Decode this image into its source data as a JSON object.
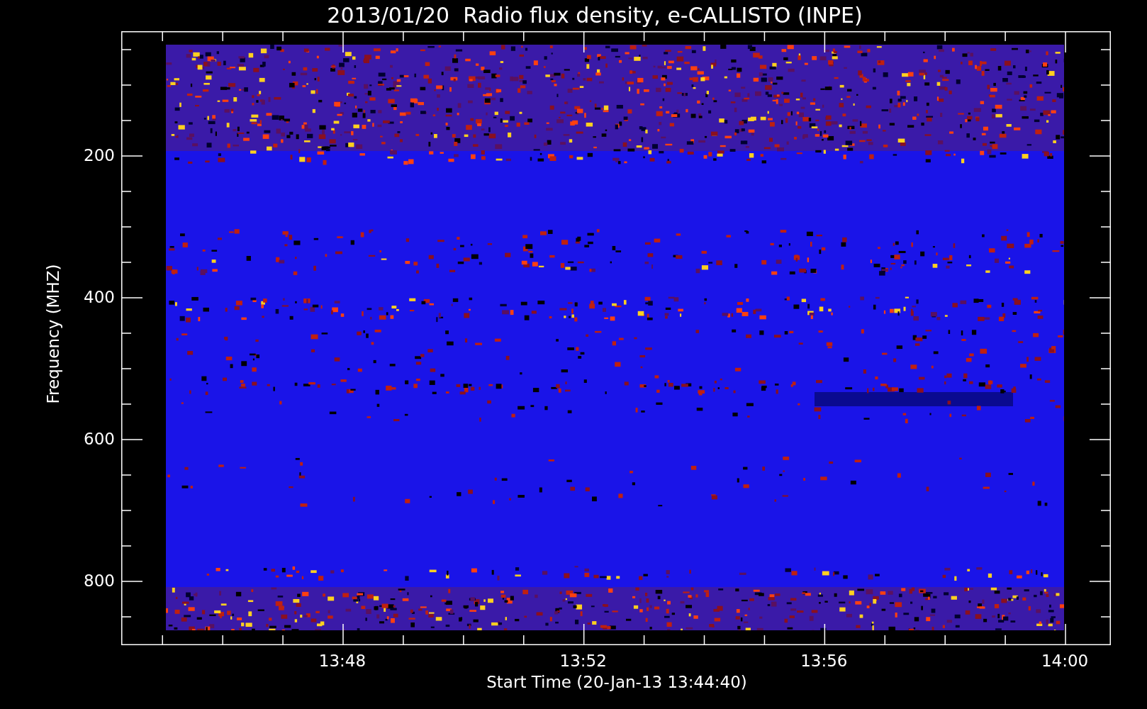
{
  "title": "2013/01/20  Radio flux density, e-CALLISTO (INPE)",
  "y_axis": {
    "label": "Frequency (MHZ)",
    "ticks": [
      "200",
      "400",
      "600",
      "800"
    ]
  },
  "x_axis": {
    "label": "Start Time (20-Jan-13 13:44:40)",
    "ticks": [
      "13:48",
      "13:52",
      "13:56",
      "14:00"
    ]
  }
}
